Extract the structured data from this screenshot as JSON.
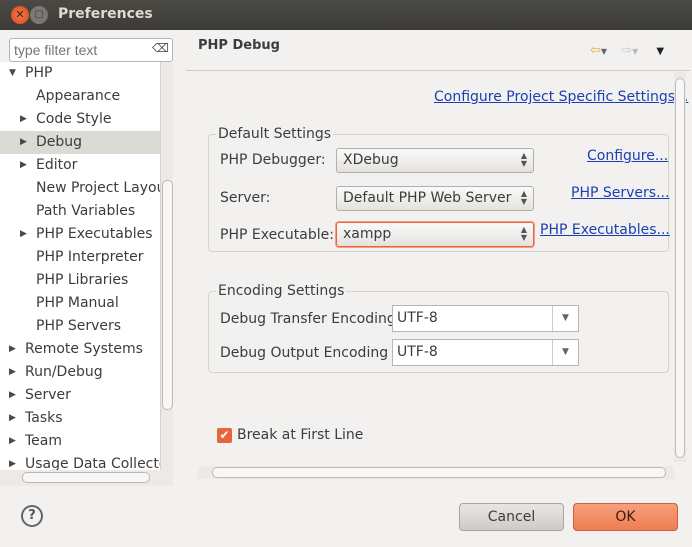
{
  "window": {
    "title": "Preferences"
  },
  "filter": {
    "placeholder": "type filter text"
  },
  "tree": [
    {
      "label": "PHP",
      "level": 0,
      "expander": "expanded"
    },
    {
      "label": "Appearance",
      "level": 1,
      "expander": "none"
    },
    {
      "label": "Code Style",
      "level": 1,
      "expander": "collapsed"
    },
    {
      "label": "Debug",
      "level": 1,
      "expander": "collapsed",
      "selected": true
    },
    {
      "label": "Editor",
      "level": 1,
      "expander": "collapsed"
    },
    {
      "label": "New Project Layout",
      "level": 1,
      "expander": "none"
    },
    {
      "label": "Path Variables",
      "level": 1,
      "expander": "none"
    },
    {
      "label": "PHP Executables",
      "level": 1,
      "expander": "collapsed"
    },
    {
      "label": "PHP Interpreter",
      "level": 1,
      "expander": "none"
    },
    {
      "label": "PHP Libraries",
      "level": 1,
      "expander": "none"
    },
    {
      "label": "PHP Manual",
      "level": 1,
      "expander": "none"
    },
    {
      "label": "PHP Servers",
      "level": 1,
      "expander": "none"
    },
    {
      "label": "Remote Systems",
      "level": 0,
      "expander": "collapsed"
    },
    {
      "label": "Run/Debug",
      "level": 0,
      "expander": "collapsed"
    },
    {
      "label": "Server",
      "level": 0,
      "expander": "collapsed"
    },
    {
      "label": "Tasks",
      "level": 0,
      "expander": "collapsed"
    },
    {
      "label": "Team",
      "level": 0,
      "expander": "collapsed"
    },
    {
      "label": "Usage Data Collector",
      "level": 0,
      "expander": "collapsed"
    }
  ],
  "page": {
    "title": "PHP Debug",
    "configure_project_link": "Configure Project Specific Settings...",
    "default_settings": {
      "legend": "Default Settings",
      "debugger_label": "PHP Debugger:",
      "debugger_value": "XDebug",
      "debugger_link": "Configure...",
      "server_label": "Server:",
      "server_value": "Default PHP Web Server",
      "server_link": "PHP Servers...",
      "exe_label": "PHP Executable:",
      "exe_value": "xampp",
      "exe_link": "PHP Executables..."
    },
    "encoding_settings": {
      "legend": "Encoding Settings",
      "transfer_label": "Debug Transfer Encoding",
      "transfer_value": "UTF-8",
      "output_label": "Debug Output Encoding",
      "output_value": "UTF-8"
    },
    "break_first_line": {
      "label": "Break at First Line",
      "checked": true
    }
  },
  "buttons": {
    "cancel": "Cancel",
    "ok": "OK"
  },
  "colors": {
    "accent": "#e8643a",
    "link": "#1a3fb3",
    "ok_button": "#f08a64"
  }
}
